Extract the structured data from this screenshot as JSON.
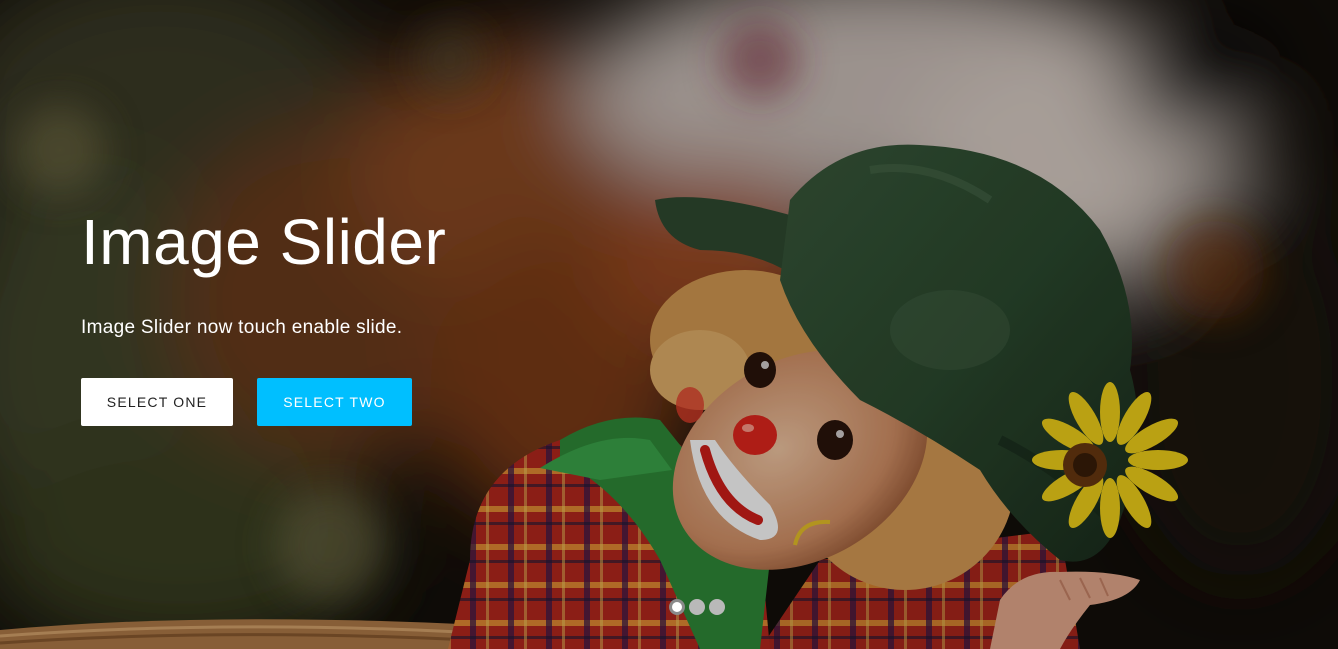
{
  "slider": {
    "title": "Image Slider",
    "subtitle": "Image Slider now touch enable slide.",
    "buttons": {
      "one": "SELECT ONE",
      "two": "SELECT TWO"
    },
    "slide_count": 3,
    "active_slide": 1,
    "image_subject": "clown-doll-photo"
  },
  "colors": {
    "primary_button_bg": "#ffffff",
    "secondary_button_bg": "#00bfff",
    "caption_text": "#ffffff",
    "dot_inactive": "#b9b9b9",
    "dot_active": "#ffffff"
  }
}
